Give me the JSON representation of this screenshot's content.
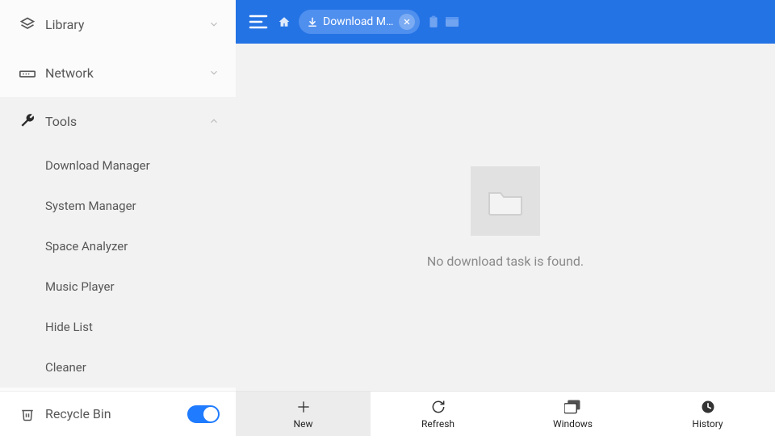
{
  "sidebar": {
    "groups": [
      {
        "label": "Library",
        "expanded": false
      },
      {
        "label": "Network",
        "expanded": false
      },
      {
        "label": "Tools",
        "expanded": true
      }
    ],
    "tools_items": [
      "Download Manager",
      "System Manager",
      "Space Analyzer",
      "Music Player",
      "Hide List",
      "Cleaner"
    ],
    "footer": {
      "label": "Recycle Bin",
      "toggle_on": true
    }
  },
  "topbar": {
    "crumb_label": "Download Ma…"
  },
  "content": {
    "empty_message": "No download task is found."
  },
  "bottombar": {
    "buttons": [
      "New",
      "Refresh",
      "Windows",
      "History"
    ]
  },
  "colors": {
    "accent": "#2473e5"
  }
}
